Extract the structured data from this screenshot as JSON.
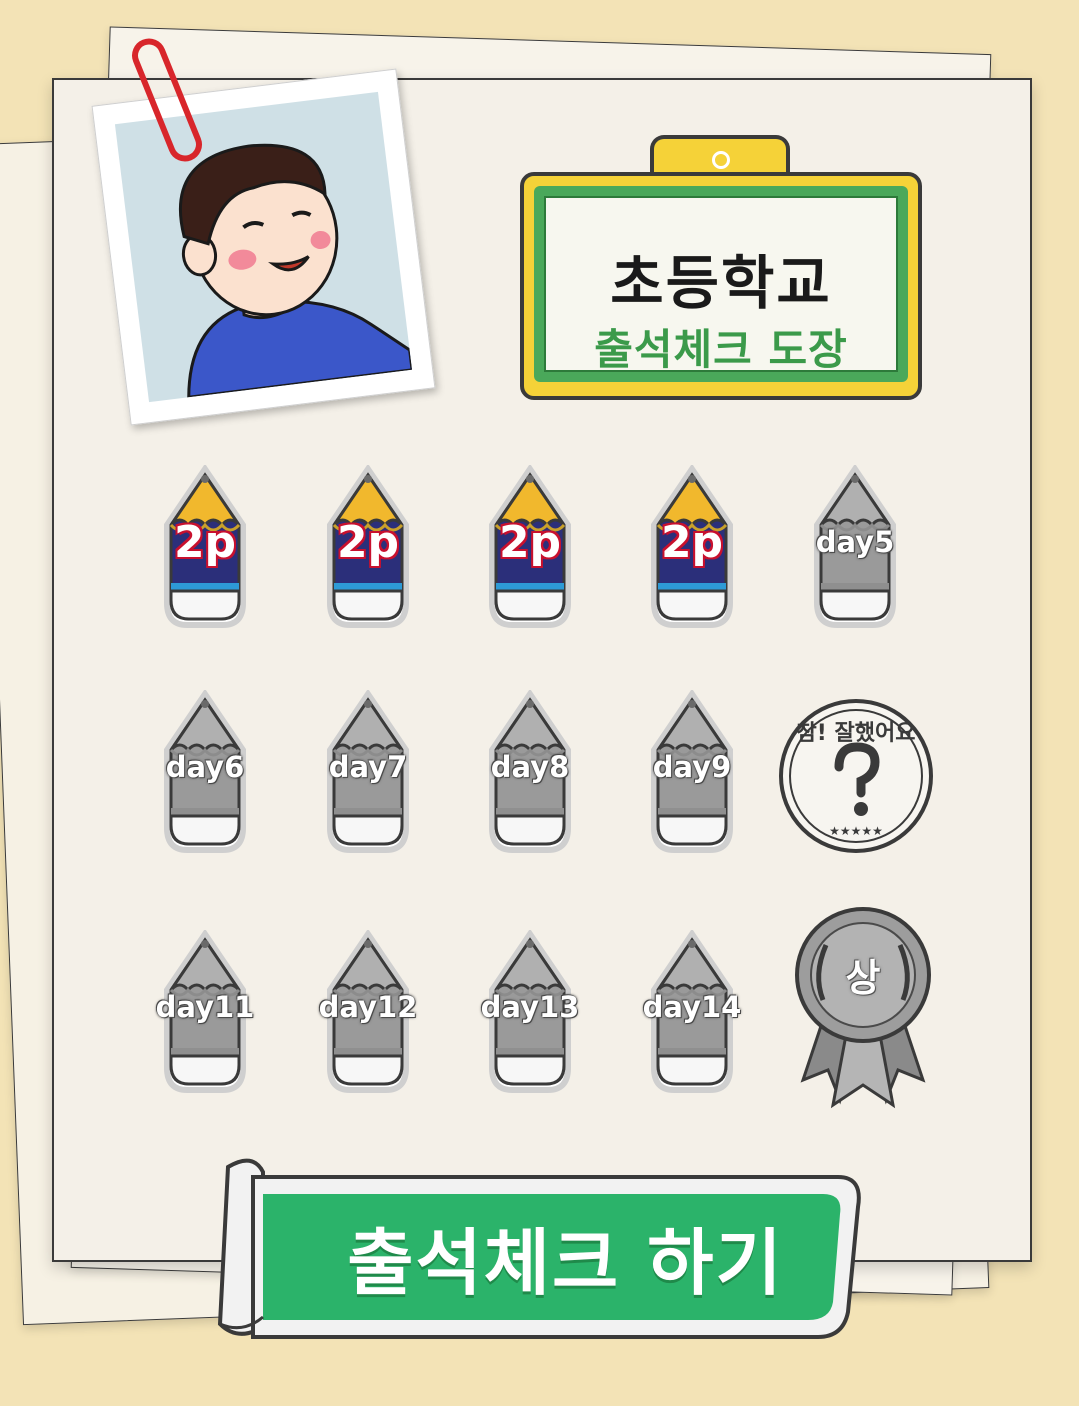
{
  "sign": {
    "title": "초등학교",
    "subtitle": "출석체크 도장"
  },
  "pencils": [
    {
      "label": "2p",
      "state": "stamped"
    },
    {
      "label": "2p",
      "state": "stamped"
    },
    {
      "label": "2p",
      "state": "stamped"
    },
    {
      "label": "2p",
      "state": "stamped"
    },
    {
      "label": "day5",
      "state": "locked"
    },
    {
      "label": "day6",
      "state": "locked"
    },
    {
      "label": "day7",
      "state": "locked"
    },
    {
      "label": "day8",
      "state": "locked"
    },
    {
      "label": "day9",
      "state": "locked"
    },
    {
      "label": "day11",
      "state": "locked"
    },
    {
      "label": "day12",
      "state": "locked"
    },
    {
      "label": "day13",
      "state": "locked"
    },
    {
      "label": "day14",
      "state": "locked"
    }
  ],
  "reward_stamp": {
    "text": "참! 잘했어요",
    "icon": "thumbs-up-question-icon",
    "state": "locked"
  },
  "reward_medal": {
    "text": "상",
    "icon": "laurel-medal-icon",
    "state": "locked"
  },
  "cta": {
    "label": "출석체크 하기"
  },
  "colors": {
    "background": "#f3e3b6",
    "sign_yellow": "#f5d238",
    "sign_green": "#3b9a4a",
    "cta_green": "#2bb36a",
    "stamped_blue": "#2b2f7a",
    "stamped_red": "#c8102e",
    "locked_gray": "#9a9a9a"
  }
}
